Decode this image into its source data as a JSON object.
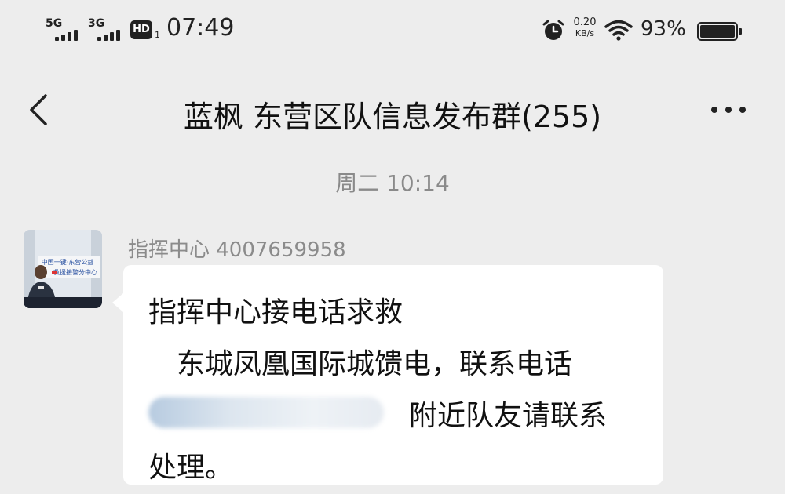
{
  "status_bar": {
    "sig1_label": "5G",
    "sig2_label": "3G",
    "hd_label": "HD",
    "hd_sub": "1",
    "time": "07:49",
    "net_speed_value": "0.20",
    "net_speed_unit": "KB/s",
    "battery_percent": "93%"
  },
  "nav": {
    "title": "蓝枫 东营区队信息发布群(255)",
    "back_icon": "back-chevron-icon",
    "more_icon": "more-dots-icon"
  },
  "chat": {
    "timestamp": "周二 10:14",
    "message": {
      "sender": "指挥中心 4007659958",
      "line1": "指挥中心接电话求救",
      "line2": "东城凤凰国际城馈电，联系电话",
      "line3": "附近队友请联系",
      "line4": "处理。"
    },
    "avatar": {
      "banner_line1": "中国一键·东营公益",
      "banner_line2": "救援接警分中心"
    }
  }
}
